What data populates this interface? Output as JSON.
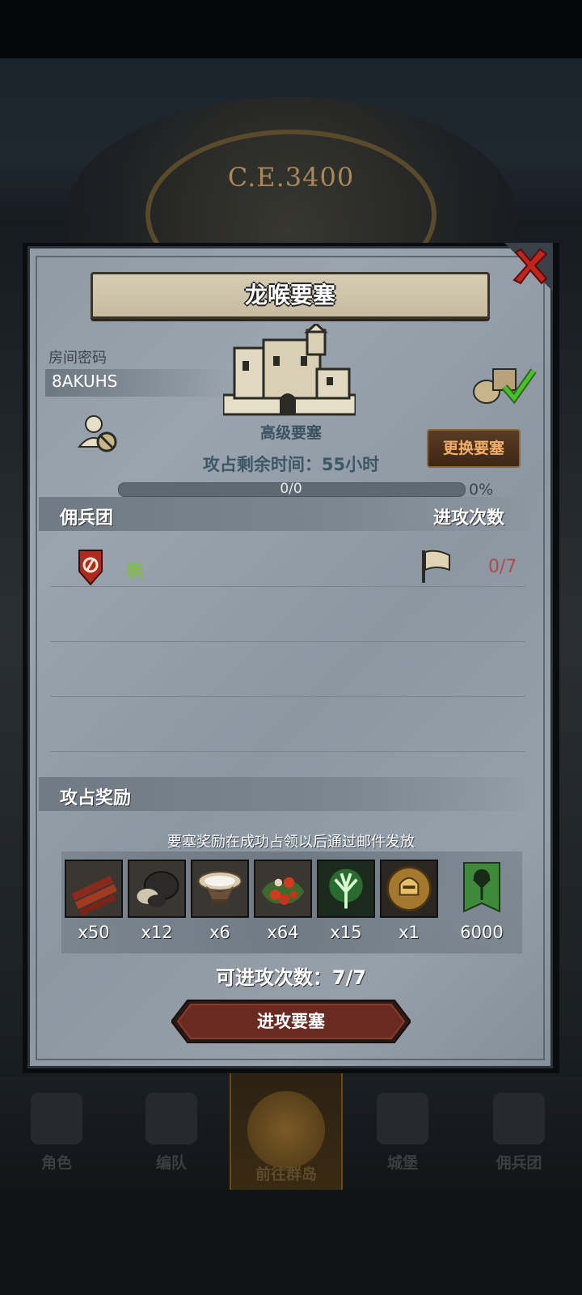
{
  "background": {
    "clock_text": "C.E.3400"
  },
  "panel": {
    "title": "龙喉要塞",
    "room_password_label": "房间密码",
    "room_code": "8AKUHS",
    "fortress_type": "高级要塞",
    "change_fortress_label": "更换要塞",
    "remaining_time": "攻占剩余时间：55小时",
    "progress": {
      "text": "0/0",
      "percent_label": "0%",
      "fraction": 0
    },
    "mercenary_section_label": "佣兵团",
    "attack_count_header": "进攻次数",
    "guild": {
      "name": "枫",
      "attacks": "0/7"
    },
    "rewards_section_label": "攻占奖励",
    "rewards_note": "要塞奖励在成功占领以后通过邮件发放",
    "rewards": [
      {
        "icon": "wood-planks-icon",
        "qty": "x50"
      },
      {
        "icon": "ore-rock-icon",
        "qty": "x12"
      },
      {
        "icon": "milk-bowl-icon",
        "qty": "x6"
      },
      {
        "icon": "berries-icon",
        "qty": "x64"
      },
      {
        "icon": "green-tree-crystal-icon",
        "qty": "x15"
      },
      {
        "icon": "knight-helmet-medal-icon",
        "qty": "x1"
      },
      {
        "icon": "tree-banner-icon",
        "qty": "6000"
      }
    ],
    "attacks_available": "可进攻次数：7/7",
    "attack_button_label": "进攻要塞"
  },
  "nav": [
    {
      "label": "角色",
      "icon": "knight-icon"
    },
    {
      "label": "编队",
      "icon": "formation-icon"
    },
    {
      "label": "前往群岛",
      "icon": "islands-globe-icon"
    },
    {
      "label": "城堡",
      "icon": "castle-icon"
    },
    {
      "label": "佣兵团",
      "icon": "mercenary-icon"
    }
  ],
  "colors": {
    "accent_gold": "#f0b06a",
    "guild_green": "#7fbe4a",
    "attack_red": "#b04a4a"
  }
}
